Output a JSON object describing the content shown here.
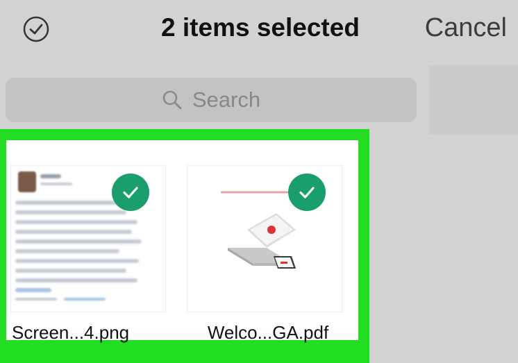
{
  "header": {
    "title": "2 items selected",
    "cancel_label": "Cancel",
    "select_icon": "checkmark-circle-icon"
  },
  "search": {
    "placeholder": "Search",
    "icon": "search-icon"
  },
  "files": [
    {
      "name": "Screen...4.png",
      "selected": true,
      "thumbnail": "screenshot-icon"
    },
    {
      "name": "Welco...GA.pdf",
      "selected": true,
      "thumbnail": "laptop-icon"
    }
  ],
  "colors": {
    "highlight": "#22dd22",
    "selected_badge": "#1a9e6e",
    "background": "#d2d2d2"
  }
}
